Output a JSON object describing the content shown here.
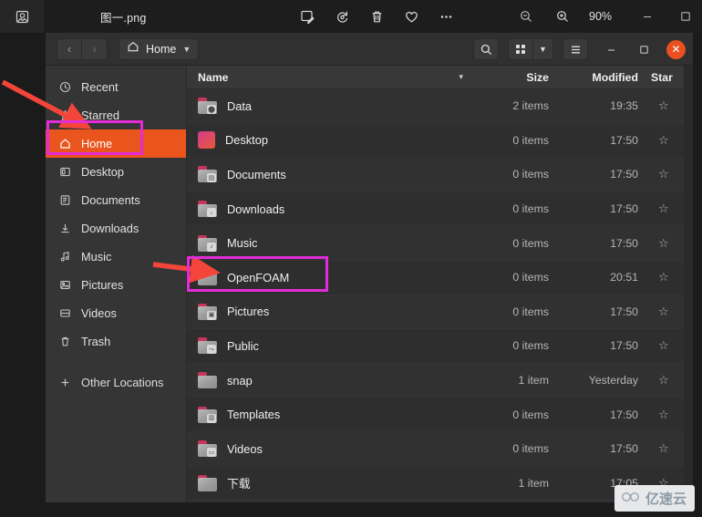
{
  "viewer": {
    "app_icon": "image-viewer-icon",
    "title": "图一.png",
    "tools": [
      {
        "name": "edit-image-icon",
        "label": "✎"
      },
      {
        "name": "rotate-icon",
        "label": "↺"
      },
      {
        "name": "trash-icon",
        "label": "🗑"
      },
      {
        "name": "favorite-heart-icon",
        "label": "♡"
      },
      {
        "name": "more-options-icon",
        "label": "⋯"
      }
    ],
    "zoom_out_label": "−",
    "zoom_in_label": "+",
    "zoom_level": "90%",
    "minimize_label": "—",
    "maximize_label": "□"
  },
  "filemanager": {
    "nav": {
      "back": "‹",
      "forward": "›"
    },
    "path": {
      "icon": "home-icon",
      "label": "Home",
      "dropdown": "▾"
    },
    "header_buttons": {
      "search": "search-icon",
      "grid_view": "grid-view-icon",
      "view_dropdown": "▾",
      "menu": "hamburger-menu-icon",
      "minimize": "—",
      "maximize": "□",
      "close": "✕"
    },
    "sidebar": {
      "items": [
        {
          "label": "Recent",
          "icon": "clock-icon",
          "active": false
        },
        {
          "label": "Starred",
          "icon": "star-icon",
          "active": false
        },
        {
          "label": "Home",
          "icon": "home-icon",
          "active": true
        },
        {
          "label": "Desktop",
          "icon": "desktop-icon",
          "active": false
        },
        {
          "label": "Documents",
          "icon": "document-icon",
          "active": false
        },
        {
          "label": "Downloads",
          "icon": "download-icon",
          "active": false
        },
        {
          "label": "Music",
          "icon": "music-note-icon",
          "active": false
        },
        {
          "label": "Pictures",
          "icon": "picture-icon",
          "active": false
        },
        {
          "label": "Videos",
          "icon": "video-icon",
          "active": false
        },
        {
          "label": "Trash",
          "icon": "trash-icon",
          "active": false
        }
      ],
      "other_locations": {
        "label": "Other Locations",
        "icon": "plus-icon"
      }
    },
    "columns": {
      "name": "Name",
      "sort_indicator": "▾",
      "size": "Size",
      "modified": "Modified",
      "star": "Star"
    },
    "rows": [
      {
        "name": "Data",
        "size": "2 items",
        "modified": "19:35",
        "star": "☆",
        "icon": "folder-with-disk-emblem",
        "emblem": "⬤"
      },
      {
        "name": "Desktop",
        "size": "0 items",
        "modified": "17:50",
        "star": "☆",
        "icon": "desktop-gradient-icon"
      },
      {
        "name": "Documents",
        "size": "0 items",
        "modified": "17:50",
        "star": "☆",
        "icon": "folder-documents-icon",
        "emblem": "▤"
      },
      {
        "name": "Downloads",
        "size": "0 items",
        "modified": "17:50",
        "star": "☆",
        "icon": "folder-downloads-icon",
        "emblem": "↓"
      },
      {
        "name": "Music",
        "size": "0 items",
        "modified": "17:50",
        "star": "☆",
        "icon": "folder-music-icon",
        "emblem": "♪"
      },
      {
        "name": "OpenFOAM",
        "size": "0 items",
        "modified": "20:51",
        "star": "☆",
        "icon": "folder-icon"
      },
      {
        "name": "Pictures",
        "size": "0 items",
        "modified": "17:50",
        "star": "☆",
        "icon": "folder-pictures-icon",
        "emblem": "▣"
      },
      {
        "name": "Public",
        "size": "0 items",
        "modified": "17:50",
        "star": "☆",
        "icon": "folder-public-icon",
        "emblem": "⤳"
      },
      {
        "name": "snap",
        "size": "1 item",
        "modified": "Yesterday",
        "star": "☆",
        "icon": "folder-icon"
      },
      {
        "name": "Templates",
        "size": "0 items",
        "modified": "17:50",
        "star": "☆",
        "icon": "folder-templates-icon",
        "emblem": "▥"
      },
      {
        "name": "Videos",
        "size": "0 items",
        "modified": "17:50",
        "star": "☆",
        "icon": "folder-videos-icon",
        "emblem": "▭"
      },
      {
        "name": "下载",
        "size": "1 item",
        "modified": "17:05",
        "star": "☆",
        "icon": "folder-icon"
      }
    ]
  },
  "annotations": {
    "highlight_color": "#e32bd8",
    "arrow_color": "#f4453a",
    "boxes": [
      "sidebar-home",
      "row-openfoam"
    ],
    "arrows": [
      "arrow-to-home",
      "arrow-to-openfoam"
    ]
  },
  "watermark": {
    "logo": "cloud-logo",
    "text": "亿速云"
  }
}
